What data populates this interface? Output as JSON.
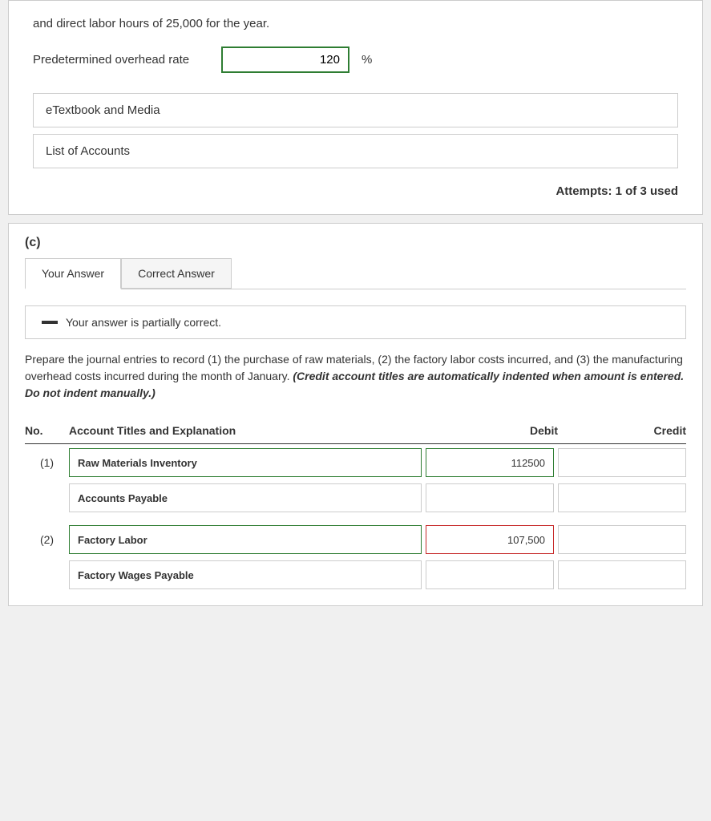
{
  "page": {
    "top_section": {
      "intro_text": "and direct labor hours of 25,000 for the year.",
      "overhead_rate_label": "Predetermined overhead rate",
      "overhead_rate_value": "120",
      "percent_symbol": "%",
      "etextbook_label": "eTextbook and Media",
      "list_of_accounts_label": "List of Accounts",
      "attempts_text": "Attempts: 1 of 3 used"
    },
    "part_c": {
      "part_label": "(c)",
      "tabs": [
        {
          "label": "Your Answer",
          "active": true
        },
        {
          "label": "Correct Answer",
          "active": false
        }
      ],
      "status_message": "Your answer is partially correct.",
      "question_text": "Prepare the journal entries to record (1) the purchase of raw materials, (2) the factory labor costs incurred, and (3) the manufacturing overhead costs incurred during the month of January.",
      "question_italic": "(Credit account titles are automatically indented when amount is entered. Do not indent manually.)",
      "table_headers": {
        "no": "No.",
        "account": "Account Titles and Explanation",
        "debit": "Debit",
        "credit": "Credit"
      },
      "rows": [
        {
          "no": "(1)",
          "account": "Raw Materials Inventory",
          "debit": "112500",
          "credit": "",
          "account_status": "correct",
          "debit_status": "correct",
          "credit_status": "normal"
        },
        {
          "no": "",
          "account": "Accounts Payable",
          "debit": "",
          "credit": "",
          "account_status": "normal",
          "debit_status": "normal",
          "credit_status": "normal"
        },
        {
          "no": "(2)",
          "account": "Factory Labor",
          "debit": "107,500",
          "credit": "",
          "account_status": "correct",
          "debit_status": "error",
          "credit_status": "normal"
        },
        {
          "no": "",
          "account": "Factory Wages Payable",
          "debit": "",
          "credit": "",
          "account_status": "normal",
          "debit_status": "normal",
          "credit_status": "normal"
        }
      ]
    }
  }
}
